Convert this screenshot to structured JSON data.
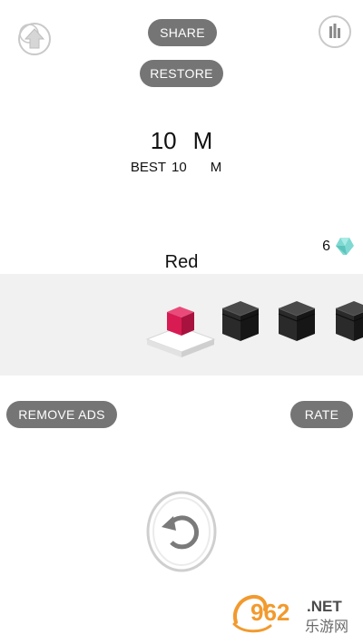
{
  "header": {
    "share_label": "SHARE",
    "restore_label": "RESTORE"
  },
  "score": {
    "current_value": "10",
    "current_unit": "M",
    "best_label": "BEST",
    "best_value": "10",
    "best_unit": "M"
  },
  "gems": {
    "count": "6"
  },
  "skins": {
    "selected_name": "Red",
    "items": [
      {
        "name": "Red",
        "selected": true,
        "locked": false,
        "color": "#d81b52"
      },
      {
        "name": "locked-1",
        "selected": false,
        "locked": true,
        "color": "#2a2a2a"
      },
      {
        "name": "locked-2",
        "selected": false,
        "locked": true,
        "color": "#2a2a2a"
      },
      {
        "name": "locked-3",
        "selected": false,
        "locked": true,
        "color": "#2a2a2a"
      }
    ]
  },
  "actions": {
    "remove_ads_label": "REMOVE ADS",
    "rate_label": "RATE"
  },
  "icons": {
    "top_left": "home-icon",
    "top_right": "leaderboard-icon",
    "replay": "replay-icon",
    "gem": "gem-icon"
  },
  "watermark": {
    "number": "962",
    "tld": ".NET",
    "cn": "乐游网"
  },
  "colors": {
    "pill_bg": "#757575",
    "strip_bg": "#f1f1f1",
    "accent_red": "#d81b52",
    "gem": "#7fd9d2"
  }
}
